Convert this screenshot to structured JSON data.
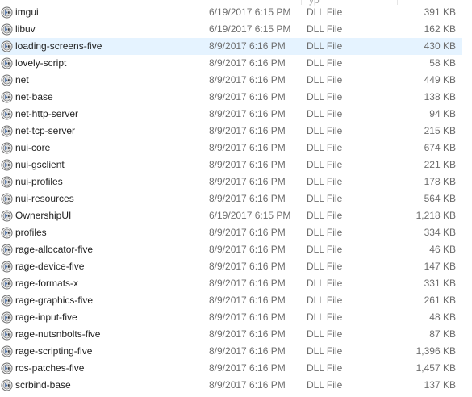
{
  "header": {
    "type_fragment": "yp"
  },
  "files": [
    {
      "name": "imgui",
      "date": "6/19/2017 6:15 PM",
      "type": "DLL File",
      "size": "391 KB",
      "selected": false
    },
    {
      "name": "libuv",
      "date": "6/19/2017 6:15 PM",
      "type": "DLL File",
      "size": "162 KB",
      "selected": false
    },
    {
      "name": "loading-screens-five",
      "date": "8/9/2017 6:16 PM",
      "type": "DLL File",
      "size": "430 KB",
      "selected": true
    },
    {
      "name": "lovely-script",
      "date": "8/9/2017 6:16 PM",
      "type": "DLL File",
      "size": "58 KB",
      "selected": false
    },
    {
      "name": "net",
      "date": "8/9/2017 6:16 PM",
      "type": "DLL File",
      "size": "449 KB",
      "selected": false
    },
    {
      "name": "net-base",
      "date": "8/9/2017 6:16 PM",
      "type": "DLL File",
      "size": "138 KB",
      "selected": false
    },
    {
      "name": "net-http-server",
      "date": "8/9/2017 6:16 PM",
      "type": "DLL File",
      "size": "94 KB",
      "selected": false
    },
    {
      "name": "net-tcp-server",
      "date": "8/9/2017 6:16 PM",
      "type": "DLL File",
      "size": "215 KB",
      "selected": false
    },
    {
      "name": "nui-core",
      "date": "8/9/2017 6:16 PM",
      "type": "DLL File",
      "size": "674 KB",
      "selected": false
    },
    {
      "name": "nui-gsclient",
      "date": "8/9/2017 6:16 PM",
      "type": "DLL File",
      "size": "221 KB",
      "selected": false
    },
    {
      "name": "nui-profiles",
      "date": "8/9/2017 6:16 PM",
      "type": "DLL File",
      "size": "178 KB",
      "selected": false
    },
    {
      "name": "nui-resources",
      "date": "8/9/2017 6:16 PM",
      "type": "DLL File",
      "size": "564 KB",
      "selected": false
    },
    {
      "name": "OwnershipUI",
      "date": "6/19/2017 6:15 PM",
      "type": "DLL File",
      "size": "1,218 KB",
      "selected": false
    },
    {
      "name": "profiles",
      "date": "8/9/2017 6:16 PM",
      "type": "DLL File",
      "size": "334 KB",
      "selected": false
    },
    {
      "name": "rage-allocator-five",
      "date": "8/9/2017 6:16 PM",
      "type": "DLL File",
      "size": "46 KB",
      "selected": false
    },
    {
      "name": "rage-device-five",
      "date": "8/9/2017 6:16 PM",
      "type": "DLL File",
      "size": "147 KB",
      "selected": false
    },
    {
      "name": "rage-formats-x",
      "date": "8/9/2017 6:16 PM",
      "type": "DLL File",
      "size": "331 KB",
      "selected": false
    },
    {
      "name": "rage-graphics-five",
      "date": "8/9/2017 6:16 PM",
      "type": "DLL File",
      "size": "261 KB",
      "selected": false
    },
    {
      "name": "rage-input-five",
      "date": "8/9/2017 6:16 PM",
      "type": "DLL File",
      "size": "48 KB",
      "selected": false
    },
    {
      "name": "rage-nutsnbolts-five",
      "date": "8/9/2017 6:16 PM",
      "type": "DLL File",
      "size": "87 KB",
      "selected": false
    },
    {
      "name": "rage-scripting-five",
      "date": "8/9/2017 6:16 PM",
      "type": "DLL File",
      "size": "1,396 KB",
      "selected": false
    },
    {
      "name": "ros-patches-five",
      "date": "8/9/2017 6:16 PM",
      "type": "DLL File",
      "size": "1,457 KB",
      "selected": false
    },
    {
      "name": "scrbind-base",
      "date": "8/9/2017 6:16 PM",
      "type": "DLL File",
      "size": "137 KB",
      "selected": false
    }
  ],
  "icon": "dll-file-icon",
  "colors": {
    "selected_row": "#e5f3ff",
    "secondary_text": "#6d6d6d"
  }
}
